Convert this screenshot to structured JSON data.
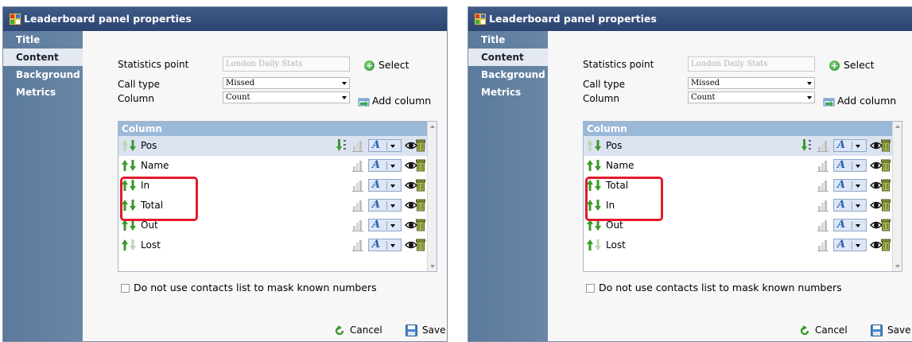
{
  "panels": [
    {
      "title": "Leaderboard panel properties",
      "sidebar": [
        "Title",
        "Content",
        "Background",
        "Metrics"
      ],
      "active_index": 1,
      "form": {
        "statistics_point_label": "Statistics point",
        "statistics_point_value": "London Daily Stats",
        "select_label": "Select",
        "call_type_label": "Call type",
        "call_type_value": "Missed",
        "column_label": "Column",
        "column_value": "Count",
        "add_column_label": "Add column"
      },
      "list_header": "Column",
      "rows": [
        "Pos",
        "Name",
        "In",
        "Total",
        "Out",
        "Lost"
      ],
      "checkbox_label": "Do not use contacts list to mask known numbers",
      "cancel_label": "Cancel",
      "save_label": "Save"
    },
    {
      "title": "Leaderboard panel properties",
      "sidebar": [
        "Title",
        "Content",
        "Background",
        "Metrics"
      ],
      "active_index": 1,
      "form": {
        "statistics_point_label": "Statistics point",
        "statistics_point_value": "London Daily Stats",
        "select_label": "Select",
        "call_type_label": "Call type",
        "call_type_value": "Missed",
        "column_label": "Column",
        "column_value": "Count",
        "add_column_label": "Add column"
      },
      "list_header": "Column",
      "rows": [
        "Pos",
        "Name",
        "Total",
        "In",
        "Out",
        "Lost"
      ],
      "checkbox_label": "Do not use contacts list to mask known numbers",
      "cancel_label": "Cancel",
      "save_label": "Save"
    }
  ],
  "colors": {
    "titlebar": "#2f4a78",
    "sidebar": "#6383a4",
    "highlight": "#e21b2b",
    "list_header": "#9ab8d8",
    "up_arrow": "#3a9a2a",
    "down_arrow": "#3a9a2a"
  },
  "icons": [
    "panel-icon",
    "select-plus-icon",
    "add-column-icon",
    "move-up-icon",
    "move-down-icon",
    "sort-icon",
    "chart-icon",
    "font-style-icon",
    "eye-icon",
    "delete-icon",
    "cancel-icon",
    "save-icon"
  ]
}
